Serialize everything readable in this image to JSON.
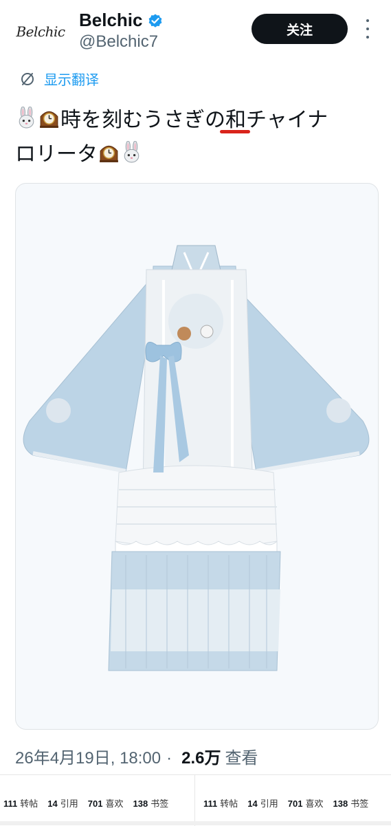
{
  "header": {
    "avatar_text": "Belchic",
    "display_name": "Belchic",
    "handle": "@Belchic7",
    "follow_label": "关注"
  },
  "translate": {
    "label": "显示翻译"
  },
  "tweet": {
    "line1_text": "時を刻むうさぎの",
    "underlined_char": "和",
    "line1_tail": "チャイナ",
    "line2_text": "ロリータ",
    "emojis": [
      "rabbit-emoji",
      "mantel-clock-emoji"
    ]
  },
  "meta": {
    "timestamp": "26年4月19日, 18:00",
    "separator": "·",
    "views_count": "2.6万",
    "views_label": "查看"
  },
  "stats": [
    {
      "retweets": "111",
      "retweets_label": "转帖",
      "quotes": "14",
      "quotes_label": "引用",
      "likes": "701",
      "likes_label": "喜欢",
      "bookmarks": "138",
      "bookmarks_label": "书签"
    },
    {
      "retweets": "111",
      "retweets_label": "转帖",
      "quotes": "14",
      "quotes_label": "引用",
      "likes": "701",
      "likes_label": "喜欢",
      "bookmarks": "138",
      "bookmarks_label": "书签"
    }
  ],
  "colors": {
    "accent": "#1d9bf0",
    "follow_bg": "#0f1419",
    "underline": "#d9231b",
    "dress_blue": "#bcd4e6"
  }
}
